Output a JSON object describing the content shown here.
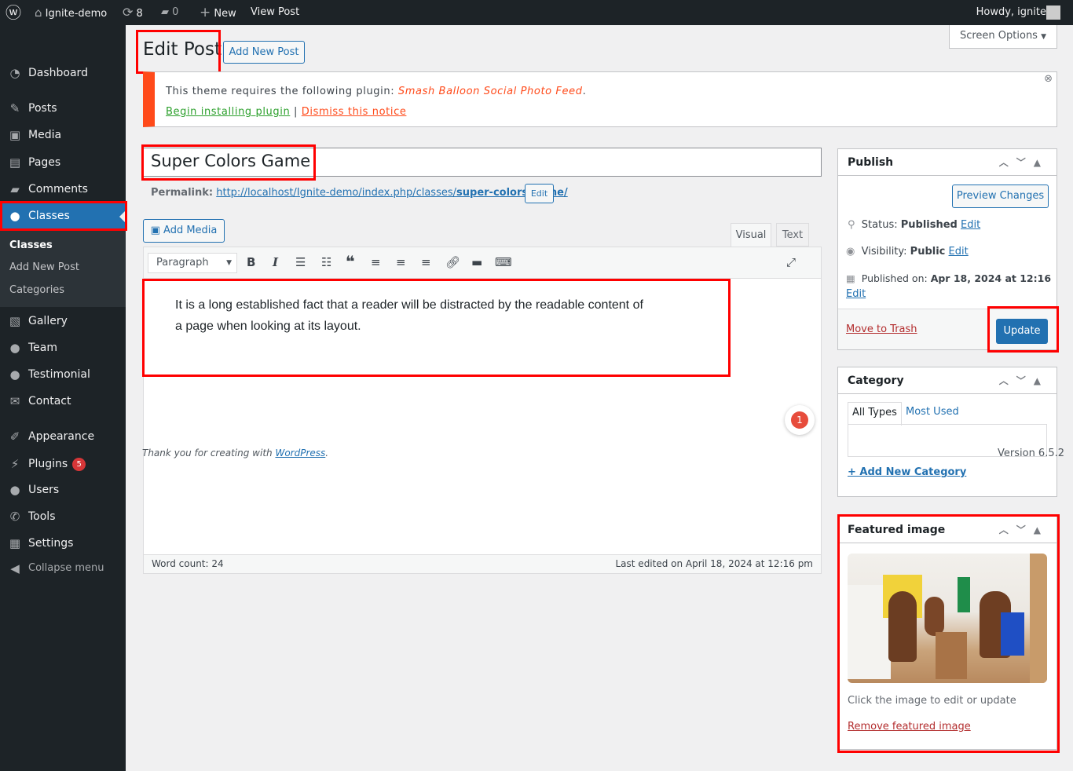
{
  "adminbar": {
    "site": "Ignite-demo",
    "updates": "8",
    "comments": "0",
    "new": "New",
    "view": "View Post",
    "howdy": "Howdy, ignite"
  },
  "sidebar": {
    "items": [
      {
        "label": "Dashboard",
        "icon": "dashboard-icon"
      },
      {
        "label": "Posts",
        "icon": "pin-icon"
      },
      {
        "label": "Media",
        "icon": "media-icon"
      },
      {
        "label": "Pages",
        "icon": "pages-icon"
      },
      {
        "label": "Comments",
        "icon": "comment-icon"
      },
      {
        "label": "Classes",
        "icon": "user-icon"
      },
      {
        "label": "Gallery",
        "icon": "gallery-icon"
      },
      {
        "label": "Team",
        "icon": "user-icon"
      },
      {
        "label": "Testimonial",
        "icon": "user-icon"
      },
      {
        "label": "Contact",
        "icon": "mail-icon"
      },
      {
        "label": "Appearance",
        "icon": "brush-icon"
      },
      {
        "label": "Plugins",
        "icon": "plugin-icon",
        "badge": "5"
      },
      {
        "label": "Users",
        "icon": "user-icon"
      },
      {
        "label": "Tools",
        "icon": "wrench-icon"
      },
      {
        "label": "Settings",
        "icon": "settings-icon"
      },
      {
        "label": "Collapse menu",
        "icon": "collapse-icon"
      }
    ],
    "submenu": [
      "Classes",
      "Add New Post",
      "Categories"
    ]
  },
  "header": {
    "title": "Edit Post",
    "add_new": "Add New Post",
    "screen_options": "Screen Options"
  },
  "notice": {
    "text": "This theme requires the following plugin: ",
    "plugin": "Smash Balloon Social Photo Feed",
    "period": ".",
    "install": "Begin installing plugin",
    "sep": "|",
    "dismiss": "Dismiss this notice"
  },
  "post": {
    "title": "Super Colors Game",
    "permalink_label": "Permalink:",
    "permalink_base": "http://localhost/Ignite-demo/index.php/classes/",
    "permalink_slug": "super-colors-game/",
    "edit": "Edit"
  },
  "editor": {
    "add_media": "Add Media",
    "tab_visual": "Visual",
    "tab_text": "Text",
    "format": "Paragraph",
    "content": "It is a long established fact that a reader will be distracted by the readable content of a page when looking at its layout.",
    "word_count": "Word count: 24",
    "last_edited": "Last edited on April 18, 2024 at 12:16 pm",
    "notification_count": "1"
  },
  "footer": {
    "thanks": "Thank you for creating with ",
    "wp": "WordPress",
    "period": ".",
    "version": "Version 6.5.2"
  },
  "publish": {
    "title": "Publish",
    "preview": "Preview Changes",
    "status_label": "Status:",
    "status": "Published",
    "visibility_label": "Visibility:",
    "visibility": "Public",
    "published_label": "Published on:",
    "published": "Apr 18, 2024 at 12:16",
    "edit": "Edit",
    "trash": "Move to Trash",
    "update": "Update"
  },
  "category": {
    "title": "Category",
    "tab_all": "All Types",
    "tab_used": "Most Used",
    "add": "+ Add New Category"
  },
  "featured": {
    "title": "Featured image",
    "hint": "Click the image to edit or update",
    "remove": "Remove featured image"
  },
  "colors": {
    "accent": "#2271b1",
    "highlight": "#ff0000",
    "notice": "#ff4a1a"
  }
}
